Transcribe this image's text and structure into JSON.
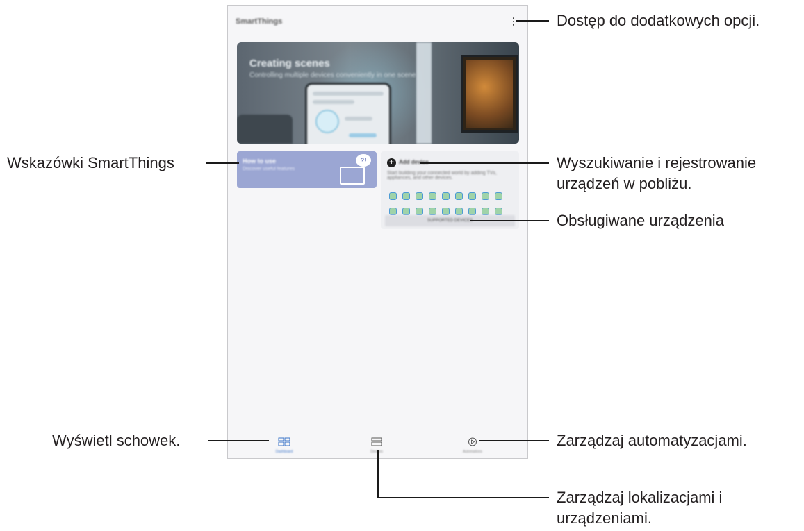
{
  "callouts": {
    "more_options": "Dostęp do dodatkowych opcji.",
    "tips": "Wskazówki SmartThings",
    "add_device_line1": "Wyszukiwanie i rejestrowanie",
    "add_device_line2": "urządzeń w pobliżu.",
    "supported_devices": "Obsługiwane urządzenia",
    "dashboard": "Wyświetl schowek.",
    "automations": "Zarządzaj automatyzacjami.",
    "devices_line1": "Zarządzaj lokalizacjami i",
    "devices_line2": "urządzeniami."
  },
  "app": {
    "title": "SmartThings",
    "banner": {
      "title": "Creating scenes",
      "subtitle": "Controlling multiple devices conveniently in one scene"
    },
    "tips_card": {
      "title": "How to use",
      "subtitle": "Discover useful features",
      "badge": "?!"
    },
    "add_device_card": {
      "label": "Add device",
      "description": "Start building your connected world by adding TVs, appliances, and other devices.",
      "supported_button": "SUPPORTED DEVICES"
    },
    "bottom_nav": {
      "dashboard": "Dashboard",
      "devices": "Devices",
      "automations": "Automations"
    }
  },
  "colors": {
    "callout_text": "#231f20",
    "tips_card": "#9ba6d3",
    "nav_active": "#3b74c8"
  },
  "icons": [
    "more-options-icon",
    "add-icon",
    "dashboard-icon",
    "devices-icon",
    "automations-icon",
    "book-icon"
  ]
}
